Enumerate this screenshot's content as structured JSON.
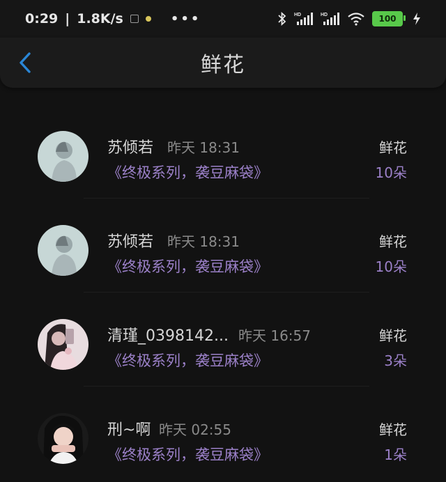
{
  "status_bar": {
    "time": "0:29",
    "separator": "|",
    "speed": "1.8K/s",
    "more": "•••",
    "battery": "100"
  },
  "nav": {
    "title": "鲜花"
  },
  "items": [
    {
      "name": "苏倾若",
      "time": "昨天 18:31",
      "book": "《终极系列，袭豆麻袋》",
      "gift_label": "鲜花",
      "gift_count": "10朵"
    },
    {
      "name": "苏倾若",
      "time": "昨天 18:31",
      "book": "《终极系列，袭豆麻袋》",
      "gift_label": "鲜花",
      "gift_count": "10朵"
    },
    {
      "name": "清瑾_0398142...",
      "time": "昨天 16:57",
      "book": "《终极系列，袭豆麻袋》",
      "gift_label": "鲜花",
      "gift_count": "3朵"
    },
    {
      "name": "刑~啊",
      "time": "昨天 02:55",
      "book": "《终极系列，袭豆麻袋》",
      "gift_label": "鲜花",
      "gift_count": "1朵"
    }
  ],
  "colors": {
    "background": "#121212",
    "accent_purple": "#9b80c8",
    "back_blue": "#2a86d6",
    "battery_green": "#58c94a"
  }
}
